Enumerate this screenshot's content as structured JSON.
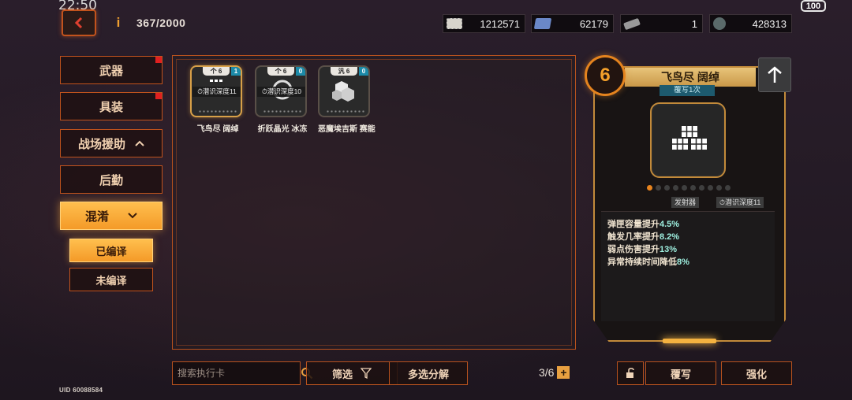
{
  "status": {
    "time": "22:50",
    "battery": "100"
  },
  "header": {
    "progress": "367/2000",
    "currencies": [
      {
        "icon": "ticket-icon",
        "value": "1212571"
      },
      {
        "icon": "blue-cube-icon",
        "value": "62179"
      },
      {
        "icon": "chip-icon",
        "value": "1"
      },
      {
        "icon": "disc-icon",
        "value": "428313"
      }
    ]
  },
  "sidebar": {
    "items": [
      {
        "label": "武器",
        "dot": true
      },
      {
        "label": "具装",
        "dot": true
      },
      {
        "label": "战场援助",
        "chevron": "^"
      },
      {
        "label": "后勤"
      },
      {
        "label": "混淆",
        "chevron": "v",
        "active": true
      }
    ],
    "sub_items": [
      {
        "label": "已编译",
        "active": true
      },
      {
        "label": "未编译"
      }
    ],
    "uid": "UID 60088584"
  },
  "cards": [
    {
      "name": "飞鸟尽 阔绰",
      "top": "个 6",
      "badge": "1",
      "depth": "潜识深度11",
      "selected": true
    },
    {
      "name": "折跃晶光 冰冻",
      "top": "个 6",
      "badge": "0",
      "depth": "潜识深度10",
      "selected": false
    },
    {
      "name": "恶魔埃吉斯 赛能",
      "top": "汎 6",
      "badge": "0",
      "depth": "",
      "selected": false
    }
  ],
  "detail": {
    "level": "6",
    "title": "飞鸟尽 阔绰",
    "subtitle": "覆写1次",
    "tags": [
      "发射器",
      "潜识深度11"
    ],
    "stats": [
      {
        "label": "弹匣容量提升",
        "value": "4.5%"
      },
      {
        "label": "触发几率提升",
        "value": "8.2%"
      },
      {
        "label": "弱点伤害提升",
        "value": "13%"
      },
      {
        "label": "异常持续时间降低",
        "value": "8%"
      }
    ]
  },
  "footer": {
    "search_placeholder": "搜索执行卡",
    "filter_label": "筛选",
    "multi_label": "多选分解",
    "page": "3/6",
    "overwrite_label": "覆写",
    "enhance_label": "强化"
  }
}
